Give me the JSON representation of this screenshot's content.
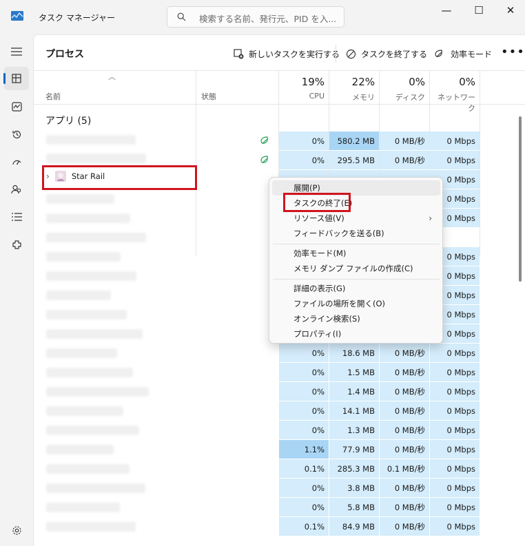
{
  "app": {
    "title": "タスク マネージャー"
  },
  "search": {
    "placeholder": "検索する名前、発行元、PID を入..."
  },
  "window_controls": {
    "minimize": "—",
    "maximize": "☐",
    "close": "✕"
  },
  "nav_icons": [
    "hamburger-icon",
    "processes-icon",
    "performance-icon",
    "app-history-icon",
    "startup-apps-icon",
    "users-icon",
    "details-icon",
    "services-icon",
    "settings-icon"
  ],
  "page": {
    "title": "プロセス"
  },
  "toolbar": {
    "new_task": "新しいタスクを実行する",
    "end_task": "タスクを終了する",
    "efficiency": "効率モード",
    "more": "•••"
  },
  "columns": {
    "name": "名前",
    "status": "状態",
    "cpu": {
      "pct": "19%",
      "label": "CPU"
    },
    "memory": {
      "pct": "22%",
      "label": "メモリ"
    },
    "disk": {
      "pct": "0%",
      "label": "ディスク"
    },
    "network": {
      "pct": "0%",
      "label": "ネットワーク"
    }
  },
  "group": {
    "label": "アプリ (5)"
  },
  "selected_app": "Star Rail",
  "rows": [
    {
      "cpu": "0%",
      "mem": "580.2 MB",
      "disk": "0 MB/秒",
      "net": "0 Mbps",
      "leaf": true
    },
    {
      "cpu": "0%",
      "mem": "295.5 MB",
      "disk": "0 MB/秒",
      "net": "0 Mbps",
      "leaf": true
    },
    {
      "cpu": "",
      "mem": "",
      "disk": "",
      "net": "0 Mbps"
    },
    {
      "cpu": "",
      "mem": "",
      "disk": "",
      "net": "0 Mbps"
    },
    {
      "cpu": "",
      "mem": "",
      "disk": "",
      "net": "0 Mbps"
    },
    {
      "cpu": "",
      "mem": "",
      "disk": "",
      "net": ""
    },
    {
      "cpu": "",
      "mem": "",
      "disk": "",
      "net": "0 Mbps"
    },
    {
      "cpu": "",
      "mem": "",
      "disk": "",
      "net": "0 Mbps"
    },
    {
      "cpu": "",
      "mem": "",
      "disk": "",
      "net": "0 Mbps"
    },
    {
      "cpu": "",
      "mem": "",
      "disk": "",
      "net": "0 Mbps"
    },
    {
      "cpu": "",
      "mem": "",
      "disk": "",
      "net": "0 Mbps"
    },
    {
      "cpu": "0%",
      "mem": "18.6 MB",
      "disk": "0 MB/秒",
      "net": "0 Mbps"
    },
    {
      "cpu": "0%",
      "mem": "1.5 MB",
      "disk": "0 MB/秒",
      "net": "0 Mbps"
    },
    {
      "cpu": "0%",
      "mem": "1.4 MB",
      "disk": "0 MB/秒",
      "net": "0 Mbps"
    },
    {
      "cpu": "0%",
      "mem": "14.1 MB",
      "disk": "0 MB/秒",
      "net": "0 Mbps"
    },
    {
      "cpu": "0%",
      "mem": "1.3 MB",
      "disk": "0 MB/秒",
      "net": "0 Mbps"
    },
    {
      "cpu": "1.1%",
      "mem": "77.9 MB",
      "disk": "0 MB/秒",
      "net": "0 Mbps",
      "cpuhi": true
    },
    {
      "cpu": "0.1%",
      "mem": "285.3 MB",
      "disk": "0.1 MB/秒",
      "net": "0 Mbps"
    },
    {
      "cpu": "0%",
      "mem": "3.8 MB",
      "disk": "0 MB/秒",
      "net": "0 Mbps"
    },
    {
      "cpu": "0%",
      "mem": "5.8 MB",
      "disk": "0 MB/秒",
      "net": "0 Mbps"
    },
    {
      "cpu": "0.1%",
      "mem": "84.9 MB",
      "disk": "0 MB/秒",
      "net": "0 Mbps"
    }
  ],
  "context_menu": {
    "items": [
      "展開(P)",
      "タスクの終了(E)",
      "リソース値(V)",
      "フィードバックを送る(B)",
      "効率モード(M)",
      "メモリ ダンプ ファイルの作成(C)",
      "詳細の表示(G)",
      "ファイルの場所を開く(O)",
      "オンライン検索(S)",
      "プロパティ(I)"
    ],
    "submenu_chevron": "›"
  },
  "colors": {
    "accent": "#0067c0",
    "highlight_red": "#d0141e",
    "heat_low": "#d4ecfb",
    "heat_mid": "#a9d5f5"
  }
}
